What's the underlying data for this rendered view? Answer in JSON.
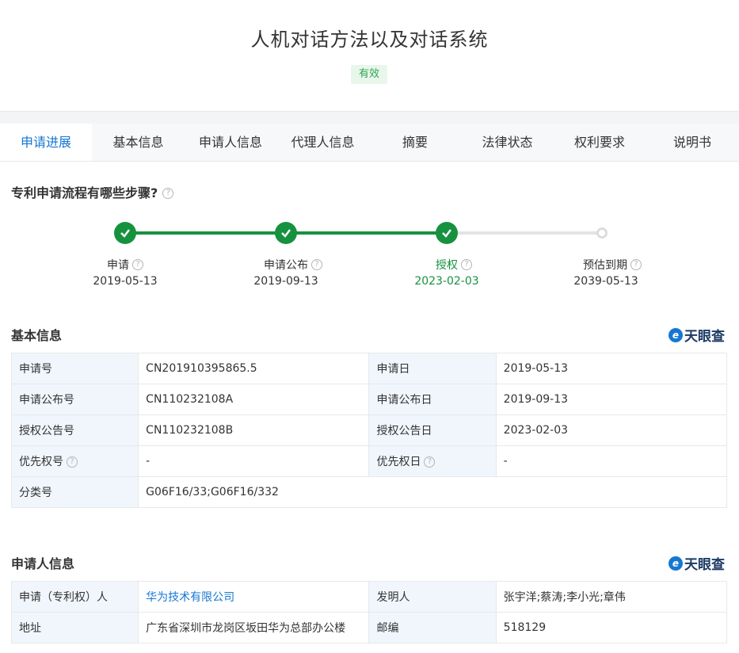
{
  "header": {
    "title": "人机对话方法以及对话系统",
    "status": "有效"
  },
  "tabs": [
    "申请进展",
    "基本信息",
    "申请人信息",
    "代理人信息",
    "摘要",
    "法律状态",
    "权利要求",
    "说明书"
  ],
  "process": {
    "question": "专利申请流程有哪些步骤?",
    "steps": [
      {
        "label": "申请",
        "date": "2019-05-13"
      },
      {
        "label": "申请公布",
        "date": "2019-09-13"
      },
      {
        "label": "授权",
        "date": "2023-02-03"
      },
      {
        "label": "预估到期",
        "date": "2039-05-13"
      }
    ]
  },
  "basic_info": {
    "heading": "基本信息",
    "brand": "天眼查",
    "rows": [
      {
        "k1": "申请号",
        "v1": "CN201910395865.5",
        "k2": "申请日",
        "v2": "2019-05-13"
      },
      {
        "k1": "申请公布号",
        "v1": "CN110232108A",
        "k2": "申请公布日",
        "v2": "2019-09-13"
      },
      {
        "k1": "授权公告号",
        "v1": "CN110232108B",
        "k2": "授权公告日",
        "v2": "2023-02-03"
      },
      {
        "k1": "优先权号",
        "v1": "-",
        "k2": "优先权日",
        "v2": "-"
      },
      {
        "k1": "分类号",
        "v1": "G06F16/33;G06F16/332"
      }
    ]
  },
  "applicant_info": {
    "heading": "申请人信息",
    "brand": "天眼查",
    "rows": [
      {
        "k1": "申请（专利权）人",
        "v1": "华为技术有限公司",
        "k2": "发明人",
        "v2": "张宇洋;蔡涛;李小光;章伟"
      },
      {
        "k1": "地址",
        "v1": "广东省深圳市龙岗区坂田华为总部办公楼",
        "k2": "邮编",
        "v2": "518129"
      }
    ]
  },
  "colors": {
    "accent": "#1677d2",
    "success": "#16923f",
    "key_bg": "#f0f6fc"
  }
}
